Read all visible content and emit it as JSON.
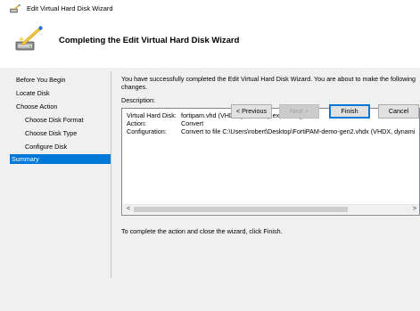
{
  "window": {
    "title": "Edit Virtual Hard Disk Wizard"
  },
  "header": {
    "title": "Completing the Edit Virtual Hard Disk Wizard",
    "icon": "wizard-disk-icon"
  },
  "nav": {
    "items": [
      {
        "label": "Before You Begin",
        "level": 0,
        "selected": false
      },
      {
        "label": "Locate Disk",
        "level": 0,
        "selected": false
      },
      {
        "label": "Choose Action",
        "level": 0,
        "selected": false
      },
      {
        "label": "Choose Disk Format",
        "level": 1,
        "selected": false
      },
      {
        "label": "Choose Disk Type",
        "level": 1,
        "selected": false
      },
      {
        "label": "Configure Disk",
        "level": 1,
        "selected": false
      },
      {
        "label": "Summary",
        "level": 0,
        "selected": true
      }
    ]
  },
  "content": {
    "intro": "You have successfully completed the Edit Virtual Hard Disk Wizard. You are about to make the following changes.",
    "description_label": "Description:",
    "description_rows": [
      {
        "key": "Virtual Hard Disk:",
        "value": "fortipam.vhd (VHD, dynamically expanding)"
      },
      {
        "key": "Action:",
        "value": "Convert"
      },
      {
        "key": "Configuration:",
        "value": "Convert to file C:\\Users\\robert\\Desktop\\FortiPAM-demo-gen2.vhdx (VHDX, dynami"
      }
    ],
    "scroll_left": "<",
    "scroll_right": ">",
    "finish_note": "To complete the action and close the wizard, click Finish."
  },
  "footer": {
    "previous_label": "< Previous",
    "next_label": "Next >",
    "finish_label": "Finish",
    "cancel_label": "Cancel"
  },
  "colors": {
    "selection": "#0078d7",
    "window_bg": "#f0f0f0",
    "header_bg": "#ffffff"
  }
}
